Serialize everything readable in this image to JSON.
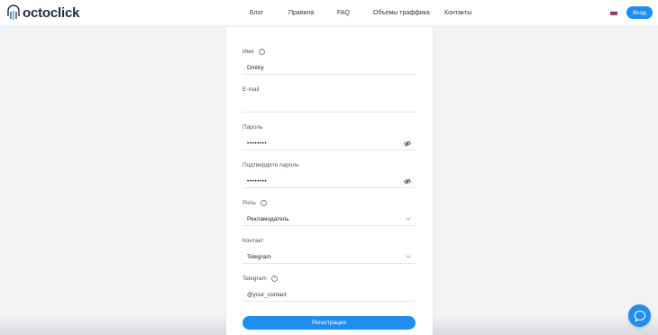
{
  "brand": {
    "name": "octoclick"
  },
  "nav": [
    {
      "label": "Блог"
    },
    {
      "label": "Правила"
    },
    {
      "label": "FAQ"
    },
    {
      "label": "Объемы траффика"
    },
    {
      "label": "Контакты"
    }
  ],
  "header": {
    "login_label": "Вход",
    "language_flag": "ru-flag"
  },
  "colors": {
    "accent": "#1f8ef1",
    "brand_dark": "#1f2a44"
  },
  "form": {
    "name": {
      "label": "Имя",
      "value": "Dmitry"
    },
    "email": {
      "label": "E-mail",
      "value": ""
    },
    "password": {
      "label": "Пароль",
      "value": "••••••••"
    },
    "confirm_password": {
      "label": "Подтвердите пароль",
      "value": "••••••••"
    },
    "role": {
      "label": "Роль",
      "value": "Рекламодатель"
    },
    "contact": {
      "label": "Контакт",
      "value": "Telegram"
    },
    "telegram": {
      "label": "Telegram",
      "placeholder": "@your_contact"
    },
    "submit_label": "Регистрация"
  },
  "widgets": {
    "chat_icon": "chat-bubble-icon"
  }
}
